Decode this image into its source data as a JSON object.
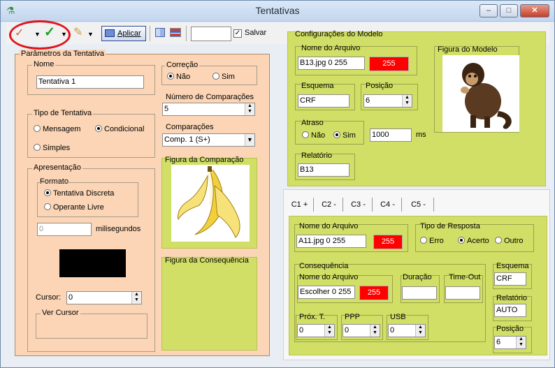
{
  "window": {
    "title": "Tentativas",
    "app_icon": "chemistry-flask-icon",
    "minimize": "–",
    "maximize": "□",
    "close": "✕"
  },
  "toolbar": {
    "cancel_icon": "✓",
    "confirm_icon": "✓",
    "pencil_icon": "✎",
    "apply_label": "Aplicar",
    "save_label": "Salvar",
    "save_checked": true
  },
  "left_panel": {
    "title": "Parâmetros da Tentativa",
    "name_group": "Nome",
    "name_value": "Tentativa 1",
    "trial_type_group": "Tipo de Tentativa",
    "opt_mensagem": "Mensagem",
    "opt_condicional": "Condicional",
    "opt_simples": "Simples",
    "presentation_group": "Apresentação",
    "format_group": "Formato",
    "opt_discreta": "Tentativa Discreta",
    "opt_operante": "Operante Livre",
    "ms_value": "0",
    "ms_label": "milisegundos",
    "cursor_label": "Cursor:",
    "cursor_value": "0",
    "see_cursor_group": "Ver Cursor",
    "correction_group": "Correção",
    "opt_nao": "Não",
    "opt_sim": "Sim",
    "comparisons_count_group": "Número de Comparações",
    "comparisons_count_value": "5",
    "comparisons_group": "Comparações",
    "comparisons_value": "Comp. 1 (S+)",
    "comparison_figure_group": "Figura da Comparação",
    "consequence_figure_group": "Figura da Consequência"
  },
  "model_panel": {
    "title": "Configurações do Modelo",
    "file_group": "Nome do Arquivo",
    "file_value": "B13.jpg 0 255",
    "file_color_value": "255",
    "figure_group": "Figura do Modelo",
    "scheme_group": "Esquema",
    "scheme_value": "CRF",
    "position_group": "Posição",
    "position_value": "6",
    "delay_group": "Atraso",
    "opt_nao": "Não",
    "opt_sim": "Sim",
    "delay_value": "1000",
    "delay_unit": "ms",
    "report_group": "Relatório",
    "report_value": "B13"
  },
  "tabs": [
    {
      "label": "C1 +"
    },
    {
      "label": "C2 -"
    },
    {
      "label": "C3 -"
    },
    {
      "label": "C4 -"
    },
    {
      "label": "C5 -"
    }
  ],
  "comparison_panel": {
    "file_group": "Nome do Arquivo",
    "file_value": "A11.jpg 0 255",
    "file_color_value": "255",
    "response_group": "Tipo de Resposta",
    "opt_erro": "Erro",
    "opt_acerto": "Acerto",
    "opt_outro": "Outro",
    "consequence_group": "Consequência",
    "cons_file_group": "Nome do Arquivo",
    "cons_file_value": "Escolher 0 255",
    "cons_color_value": "255",
    "duration_group": "Duração",
    "timeout_group": "Time-Out",
    "next_group": "Próx. T.",
    "next_value": "0",
    "ppp_group": "PPP",
    "ppp_value": "0",
    "usb_group": "USB",
    "usb_value": "0",
    "scheme_group": "Esquema",
    "scheme_value": "CRF",
    "report_group": "Relatório",
    "report_value": "AUTO",
    "position_group": "Posição",
    "position_value": "6"
  },
  "colors": {
    "left_panel_bg": "#fbd5b5",
    "green_panel_bg": "#d1df66",
    "red_accent": "#ff0000",
    "annotation_circle": "#e0141b"
  }
}
